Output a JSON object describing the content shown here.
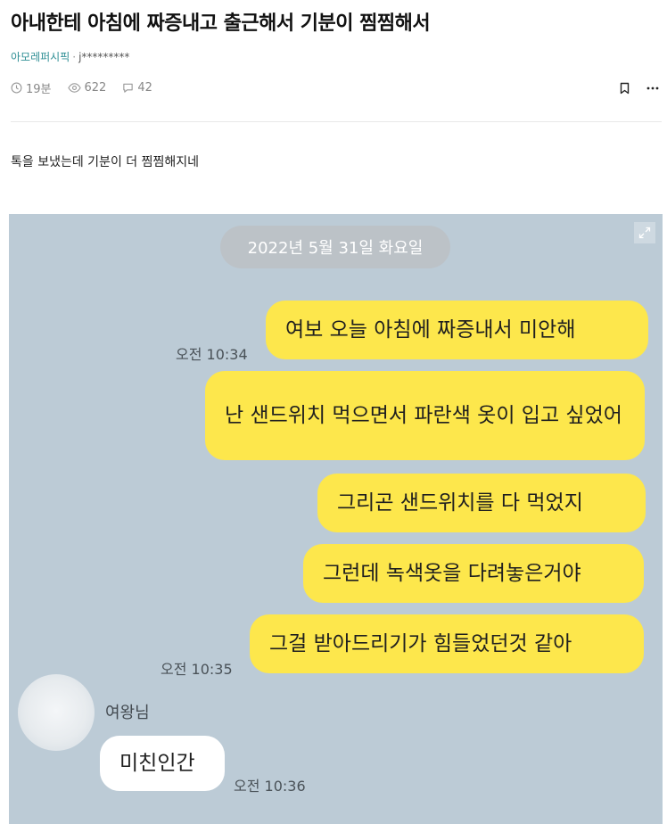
{
  "post": {
    "title": "아내한테 아침에 짜증내고 출근해서 기분이 찜찜해서",
    "board": "아모레퍼시픽",
    "separator": "·",
    "author": "j*********",
    "time_ago": "19분",
    "views": "622",
    "comments": "42",
    "body": "톡을 보냈는데 기분이 더 찜찜해지네"
  },
  "icons": {
    "clock": "clock-icon",
    "eye": "eye-icon",
    "comment": "comment-icon",
    "bookmark": "bookmark-icon",
    "more": "more-icon",
    "expand": "expand-icon"
  },
  "chat": {
    "date": "2022년 5월 31일 화요일",
    "sent_messages": [
      "여보 오늘 아침에 짜증내서 미안해",
      "난 샌드위치 먹으면서 파란색 옷이 입고 싶었어",
      "그리곤 샌드위치를 다 먹었지",
      "그런데 녹색옷을 다려놓은거야",
      "그걸 받아드리기가 힘들었던것 같아"
    ],
    "sent_times": [
      "오전 10:34",
      "오전 10:35"
    ],
    "received_sender": "여왕님",
    "received_message": "미친인간",
    "received_time": "오전 10:36"
  },
  "colors": {
    "board": "#2f8f95",
    "chat_bg": "#bccbd6",
    "sent_bubble": "#fde74c",
    "received_bubble": "#ffffff"
  }
}
